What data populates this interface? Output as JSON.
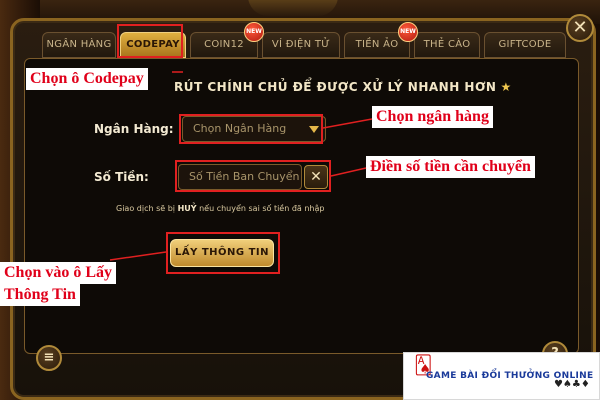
{
  "tabs": [
    {
      "label": "NGÂN HÀNG",
      "active": false
    },
    {
      "label": "CODEPAY",
      "active": true
    },
    {
      "label": "COIN12",
      "active": false
    },
    {
      "label": "VÍ ĐIỆN TỬ",
      "active": false
    },
    {
      "label": "TIỀN ẢO",
      "active": false
    },
    {
      "label": "THẺ CÀO",
      "active": false
    },
    {
      "label": "GIFTCODE",
      "active": false
    }
  ],
  "badges": {
    "new_label": "NEW"
  },
  "close_label": "✕",
  "headline": {
    "text": "RÚT CHÍNH CHỦ ĐỂ ĐƯỢC XỬ LÝ NHANH HƠN",
    "star": "★"
  },
  "form": {
    "bank_label": "Ngân Hàng:",
    "bank_placeholder": "Chọn Ngân Hàng",
    "amount_label": "Số Tiền:",
    "amount_placeholder": "Số Tiền Ban Chuyển đ",
    "clear_label": "✕",
    "note_prefix": "Giao dịch sẽ bị ",
    "note_bold": "HUỶ",
    "note_suffix": " nếu chuyển sai số tiền đã nhập",
    "fetch_button": "LẤY THÔNG TIN"
  },
  "bottom": {
    "left_icon": "≡",
    "right_icon": "?"
  },
  "annotations": {
    "codepay": "Chọn ô Codepay",
    "bank": "Chọn ngân hàng",
    "amount": "Điền số tiền cần chuyển",
    "fetch_line1": "Chọn vào ô Lấy",
    "fetch_line2": "Thông Tin"
  },
  "logo": {
    "text": "GAME BÀI ĐỔI THƯỞNG ONLINE",
    "suits": "♥♠♣♦"
  },
  "colors": {
    "accent": "#e0b040",
    "annotation": "#e0001a",
    "frame": "#8a6420"
  }
}
